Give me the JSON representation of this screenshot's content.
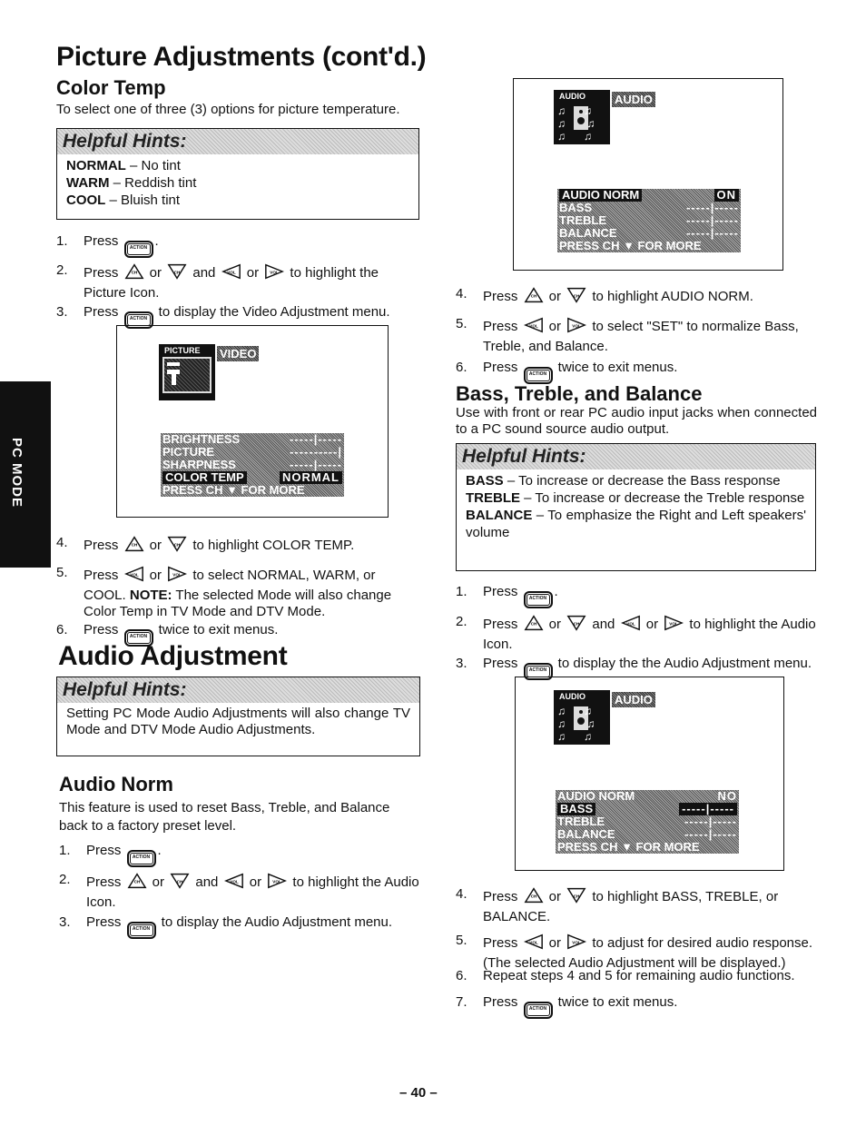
{
  "side_tab": "PC MODE",
  "left": {
    "title": "Picture Adjustments (cont'd.)",
    "color_temp": {
      "heading": "Color Temp",
      "intro": "To select one of three (3) options for picture temperature.",
      "hints_title": "Helpful Hints:",
      "hints": [
        {
          "b": "NORMAL",
          "t": " – No tint"
        },
        {
          "b": "WARM",
          "t": " – Reddish tint"
        },
        {
          "b": "COOL",
          "t": " – Bluish tint"
        }
      ],
      "steps_a": [
        [
          {
            "t": "1."
          },
          {
            "t": "Press "
          },
          {
            "i": "action"
          },
          {
            "t": "."
          }
        ],
        [
          {
            "t": "2."
          },
          {
            "t": "Press "
          },
          {
            "i": "ch-up"
          },
          {
            "t": " or "
          },
          {
            "i": "ch-down"
          },
          {
            "t": " and "
          },
          {
            "i": "vol-left"
          },
          {
            "t": " or "
          },
          {
            "i": "vol-right"
          },
          {
            "t": " to highlight the Picture Icon."
          }
        ],
        [
          {
            "t": "3."
          },
          {
            "t": "Press "
          },
          {
            "i": "action"
          },
          {
            "t": " to display the Video Adjustment menu."
          }
        ]
      ],
      "screen": {
        "icon_label": "PICTURE",
        "tag": "VIDEO",
        "rows": [
          {
            "l": "BRIGHTNESS",
            "r": "-----|-----"
          },
          {
            "l": "PICTURE",
            "r": "----------|"
          },
          {
            "l": "SHARPNESS",
            "r": "-----|-----"
          },
          {
            "l": "COLOR TEMP",
            "r": "NORMAL",
            "hl": true
          },
          {
            "l": "PRESS CH ▼ FOR MORE",
            "r": ""
          }
        ]
      },
      "steps_b": [
        [
          {
            "t": "4."
          },
          {
            "t": "Press "
          },
          {
            "i": "ch-up"
          },
          {
            "t": " or "
          },
          {
            "i": "ch-down"
          },
          {
            "t": " to highlight COLOR TEMP."
          }
        ],
        [
          {
            "t": "5."
          },
          {
            "t": "Press "
          },
          {
            "i": "vol-left"
          },
          {
            "t": " or "
          },
          {
            "i": "vol-right"
          },
          {
            "t": " to select NORMAL, WARM, or COOL. "
          },
          {
            "b": "NOTE:"
          },
          {
            "t": " The selected Mode will also change Color Temp in TV Mode and DTV Mode."
          }
        ],
        [
          {
            "t": "6."
          },
          {
            "t": "Press "
          },
          {
            "i": "action"
          },
          {
            "t": " twice to exit menus."
          }
        ]
      ]
    },
    "audio_adjustment": {
      "heading": "Audio Adjustment",
      "hints_title": "Helpful Hints:",
      "hints_text": "Setting PC Mode Audio Adjustments will also change TV Mode and DTV Mode Audio Adjustments."
    },
    "audio_norm": {
      "heading": "Audio Norm",
      "intro": "This feature is used to reset Bass, Treble, and Balance back to a factory preset level.",
      "steps": [
        [
          {
            "t": "1."
          },
          {
            "t": "Press "
          },
          {
            "i": "action"
          },
          {
            "t": "."
          }
        ],
        [
          {
            "t": "2."
          },
          {
            "t": "Press "
          },
          {
            "i": "ch-up"
          },
          {
            "t": " or "
          },
          {
            "i": "ch-down"
          },
          {
            "t": " and "
          },
          {
            "i": "vol-left"
          },
          {
            "t": " or "
          },
          {
            "i": "vol-right"
          },
          {
            "t": " to highlight the Audio Icon."
          }
        ],
        [
          {
            "t": "3."
          },
          {
            "t": "Press "
          },
          {
            "i": "action"
          },
          {
            "t": " to display the Audio Adjustment menu."
          }
        ]
      ]
    }
  },
  "right": {
    "screen1": {
      "icon_label": "AUDIO",
      "tag": "AUDIO",
      "rows": [
        {
          "l": "AUDIO NORM",
          "r": "ON",
          "hl": true
        },
        {
          "l": "BASS",
          "r": "-----|-----"
        },
        {
          "l": "TREBLE",
          "r": "-----|-----"
        },
        {
          "l": "BALANCE",
          "r": "-----|-----"
        },
        {
          "l": "PRESS CH ▼ FOR MORE",
          "r": ""
        }
      ]
    },
    "norm_steps": [
      [
        {
          "t": "4."
        },
        {
          "t": "Press "
        },
        {
          "i": "ch-up"
        },
        {
          "t": " or "
        },
        {
          "i": "ch-down"
        },
        {
          "t": " to highlight AUDIO NORM."
        }
      ],
      [
        {
          "t": "5."
        },
        {
          "t": "Press "
        },
        {
          "i": "vol-left"
        },
        {
          "t": " or "
        },
        {
          "i": "vol-right"
        },
        {
          "t": " to select \"SET\" to normalize Bass, Treble, and Balance."
        }
      ],
      [
        {
          "t": "6."
        },
        {
          "t": "Press "
        },
        {
          "i": "action"
        },
        {
          "t": " twice to exit menus."
        }
      ]
    ],
    "btb": {
      "heading": "Bass, Treble, and Balance",
      "intro": "Use with front or rear PC audio input jacks when connected to a PC sound source audio output.",
      "hints_title": "Helpful Hints:",
      "hints": [
        {
          "b": "BASS",
          "t": " – To increase or decrease the Bass response"
        },
        {
          "b": "TREBLE",
          "t": " – To increase or decrease the Treble response"
        },
        {
          "b": "BALANCE",
          "t": " – To emphasize the Right and Left speakers' volume"
        }
      ],
      "steps_a": [
        [
          {
            "t": "1."
          },
          {
            "t": "Press "
          },
          {
            "i": "action"
          },
          {
            "t": "."
          }
        ],
        [
          {
            "t": "2."
          },
          {
            "t": "Press "
          },
          {
            "i": "ch-up"
          },
          {
            "t": " or "
          },
          {
            "i": "ch-down"
          },
          {
            "t": " and "
          },
          {
            "i": "vol-left"
          },
          {
            "t": " or "
          },
          {
            "i": "vol-right"
          },
          {
            "t": " to highlight the Audio Icon."
          }
        ],
        [
          {
            "t": "3."
          },
          {
            "t": "Press "
          },
          {
            "i": "action"
          },
          {
            "t": " to display the the Audio Adjustment menu."
          }
        ]
      ],
      "screen2": {
        "icon_label": "AUDIO",
        "tag": "AUDIO",
        "rows": [
          {
            "l": "AUDIO NORM",
            "r": "NO"
          },
          {
            "l": "BASS",
            "r": "-----|-----",
            "hl": true
          },
          {
            "l": "TREBLE",
            "r": "-----|-----"
          },
          {
            "l": "BALANCE",
            "r": "-----|-----"
          },
          {
            "l": "PRESS CH ▼ FOR MORE",
            "r": ""
          }
        ]
      },
      "steps_b": [
        [
          {
            "t": "4."
          },
          {
            "t": "Press "
          },
          {
            "i": "ch-up"
          },
          {
            "t": " or "
          },
          {
            "i": "ch-down"
          },
          {
            "t": " to highlight BASS, TREBLE, or BALANCE."
          }
        ],
        [
          {
            "t": "5."
          },
          {
            "t": "Press "
          },
          {
            "i": "vol-left"
          },
          {
            "t": " or "
          },
          {
            "i": "vol-right"
          },
          {
            "t": " to adjust for desired audio response. (The selected Audio Adjustment will be displayed.)"
          }
        ],
        [
          {
            "t": "6."
          },
          {
            "t": "Repeat steps 4 and 5 for remaining audio functions."
          }
        ],
        [
          {
            "t": "7."
          },
          {
            "t": "Press "
          },
          {
            "i": "action"
          },
          {
            "t": " twice to exit menus."
          }
        ]
      ]
    }
  },
  "icon_labels": {
    "action": "ACTION",
    "ch": "CH",
    "vol": "VOL"
  },
  "page_number": "– 40 –"
}
